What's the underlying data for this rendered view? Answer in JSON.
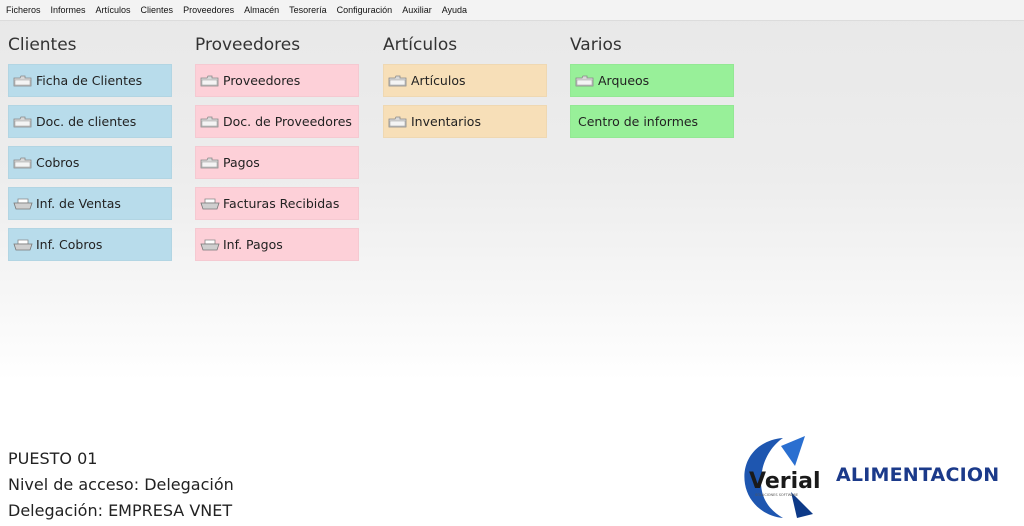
{
  "menu": [
    "Ficheros",
    "Informes",
    "Artículos",
    "Clientes",
    "Proveedores",
    "Almacén",
    "Tesorería",
    "Configuración",
    "Auxiliar",
    "Ayuda"
  ],
  "columns": [
    {
      "title": "Clientes",
      "color": "#b8dceb",
      "items": [
        {
          "label": "Ficha de Clientes",
          "icon": "folder-icon"
        },
        {
          "label": "Doc. de clientes",
          "icon": "folder-icon"
        },
        {
          "label": "Cobros",
          "icon": "folder-icon"
        },
        {
          "label": "Inf. de Ventas",
          "icon": "printer-icon"
        },
        {
          "label": "Inf. Cobros",
          "icon": "printer-icon"
        }
      ]
    },
    {
      "title": "Proveedores",
      "color": "#fdd0d8",
      "items": [
        {
          "label": "Proveedores",
          "icon": "folder-icon"
        },
        {
          "label": "Doc. de Proveedores",
          "icon": "folder-icon"
        },
        {
          "label": "Pagos",
          "icon": "folder-icon"
        },
        {
          "label": "Facturas Recibidas",
          "icon": "printer-icon"
        },
        {
          "label": "Inf. Pagos",
          "icon": "printer-icon"
        }
      ]
    },
    {
      "title": "Artículos",
      "color": "#f7dfb8",
      "items": [
        {
          "label": "Artículos",
          "icon": "folder-icon"
        },
        {
          "label": "Inventarios",
          "icon": "folder-icon"
        }
      ]
    },
    {
      "title": "Varios",
      "color": "#98f099",
      "items": [
        {
          "label": "Arqueos",
          "icon": "folder-icon"
        },
        {
          "label": "Centro de informes",
          "icon": ""
        }
      ]
    }
  ],
  "status": {
    "puesto": "PUESTO 01",
    "nivel": "Nivel de acceso: Delegación",
    "delegacion": "Delegación: EMPRESA VNET"
  },
  "logo": {
    "text": "Verial",
    "sub": "SOLUCIONES SOFTWARE"
  },
  "brand": "ALIMENTACION"
}
